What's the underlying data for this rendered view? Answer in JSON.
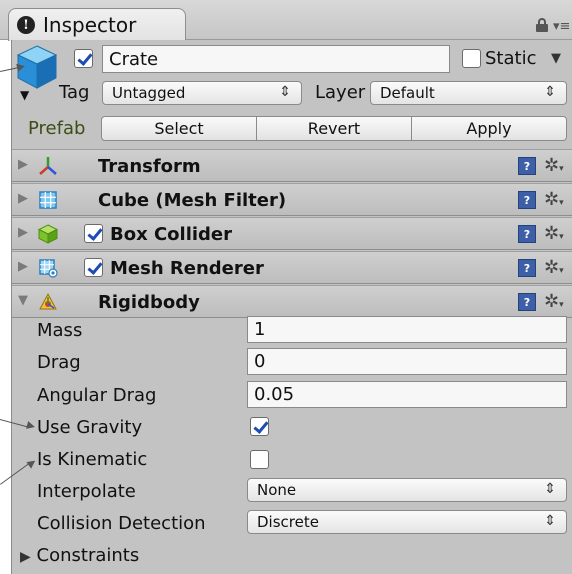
{
  "tab": {
    "label": "Inspector",
    "info_glyph": "!"
  },
  "object": {
    "name": "Crate",
    "active": true,
    "static_label": "Static",
    "static": false,
    "tag_label": "Tag",
    "tag_value": "Untagged",
    "layer_label": "Layer",
    "layer_value": "Default"
  },
  "prefab": {
    "label": "Prefab",
    "select_label": "Select",
    "revert_label": "Revert",
    "apply_label": "Apply"
  },
  "components": [
    {
      "name": "Transform",
      "expanded": false,
      "has_checkbox": false,
      "icon": "transform-axes-icon"
    },
    {
      "name": "Cube (Mesh Filter)",
      "expanded": false,
      "has_checkbox": false,
      "icon": "mesh-filter-icon"
    },
    {
      "name": "Box Collider",
      "expanded": false,
      "has_checkbox": true,
      "enabled": true,
      "icon": "box-collider-icon"
    },
    {
      "name": "Mesh Renderer",
      "expanded": false,
      "has_checkbox": true,
      "enabled": true,
      "icon": "mesh-renderer-icon"
    },
    {
      "name": "Rigidbody",
      "expanded": true,
      "has_checkbox": false,
      "icon": "rigidbody-icon"
    }
  ],
  "rigidbody": {
    "mass_label": "Mass",
    "mass": "1",
    "drag_label": "Drag",
    "drag": "0",
    "angular_drag_label": "Angular Drag",
    "angular_drag": "0.05",
    "use_gravity_label": "Use Gravity",
    "use_gravity": true,
    "is_kinematic_label": "Is Kinematic",
    "is_kinematic": false,
    "interpolate_label": "Interpolate",
    "interpolate": "None",
    "collision_detection_label": "Collision Detection",
    "collision_detection": "Discrete",
    "constraints_label": "Constraints"
  },
  "colors": {
    "panel": "#c3c3c3",
    "checkmark": "#1e4cb5",
    "help_icon": "#3c5fa7"
  }
}
